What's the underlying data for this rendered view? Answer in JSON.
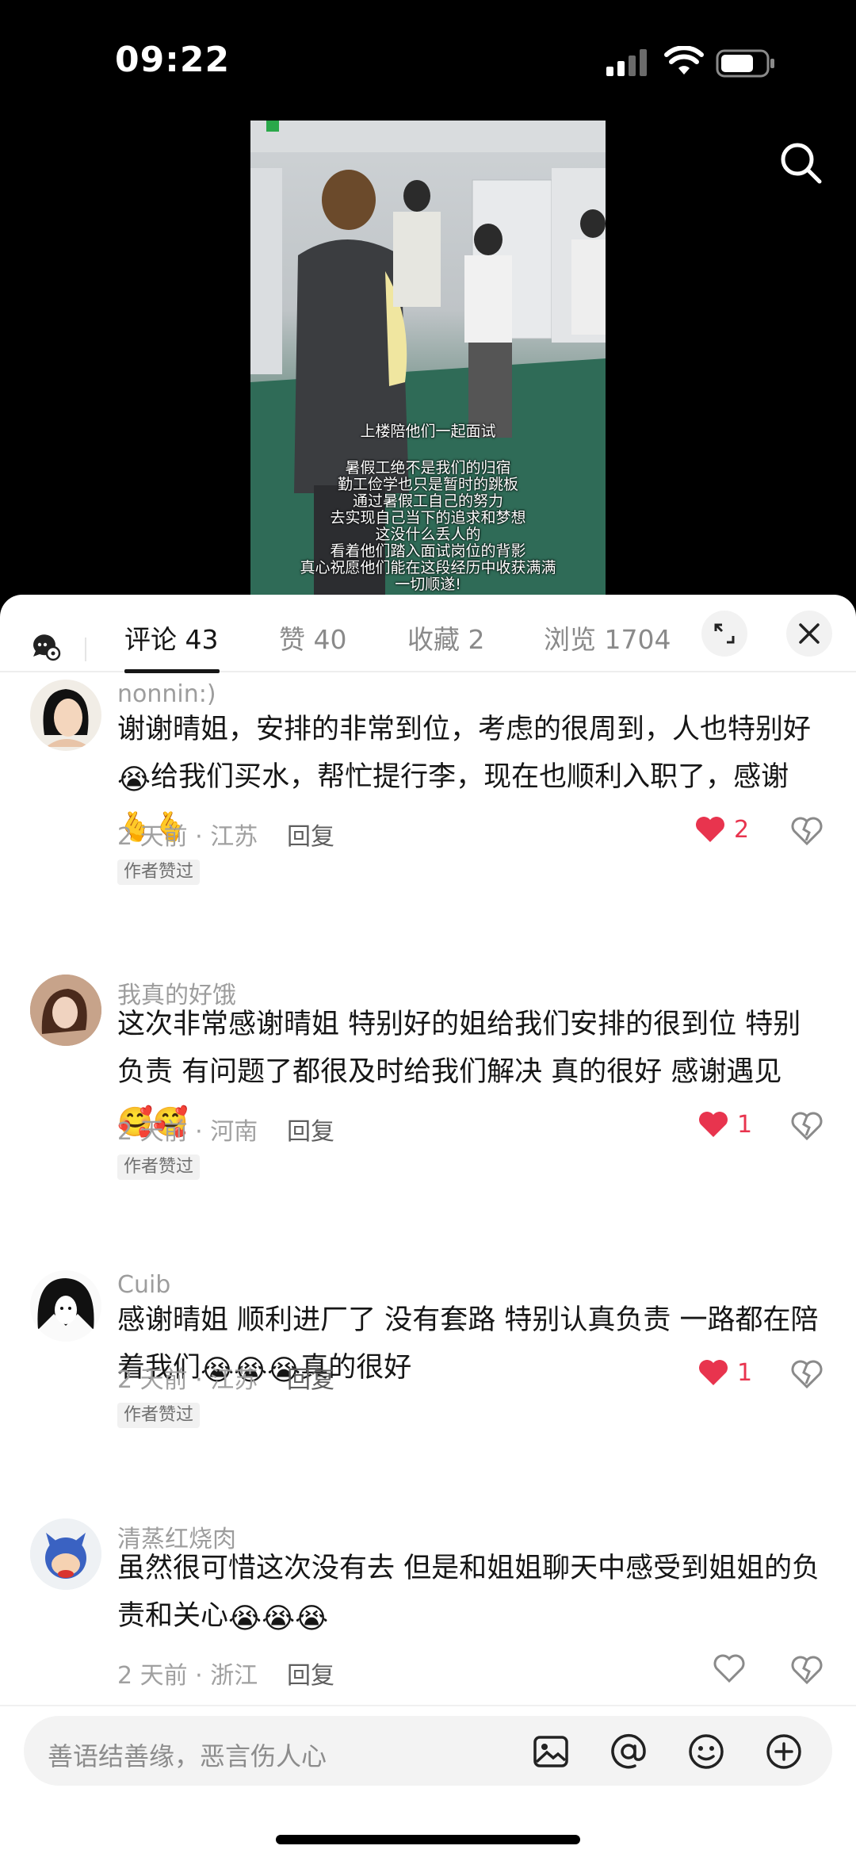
{
  "status_bar": {
    "time": "09:22"
  },
  "video": {
    "caption_title": "上楼陪他们一起面试",
    "caption_lines": [
      "暑假工绝不是我们的归宿",
      "勤工俭学也只是暂时的跳板",
      "通过暑假工自己的努力",
      "去实现自己当下的追求和梦想",
      "这没什么丢人的",
      "看着他们踏入面试岗位的背影",
      "真心祝愿他们能在这段经历中收获满满",
      "一切顺遂!"
    ]
  },
  "tabs": [
    {
      "label": "评论 43"
    },
    {
      "label": "赞 40"
    },
    {
      "label": "收藏 2"
    },
    {
      "label": "浏览 1704"
    }
  ],
  "comments": [
    {
      "username": "nonnin:)",
      "text": "谢谢晴姐，安排的非常到位，考虑的很周到，人也特别好",
      "text_after_emoji1": "给我们买水，帮忙提行李，现在也顺利入职了，感谢",
      "emoji1": "😭",
      "emoji_tail": "🫰🫰",
      "time": "2 天前 · 江苏",
      "reply": "回复",
      "likes": "2",
      "liked": true,
      "badge": "作者赞过"
    },
    {
      "username": "我真的好饿",
      "text": "这次非常感谢晴姐 特别好的姐给我们安排的很到位 特别负责 有问题了都很及时给我们解决 真的很好 感谢遇见",
      "emoji_tail": "🥰🥰",
      "time": "2 天前 · 河南",
      "reply": "回复",
      "likes": "1",
      "liked": true,
      "badge": "作者赞过"
    },
    {
      "username": "Cuib",
      "text": "感谢晴姐 顺利进厂了 没有套路 特别认真负责 一路都在陪着我们",
      "emoji_mid": "😭😭😭",
      "text_after": "真的很好",
      "time": "2 天前 · 江苏",
      "reply": "回复",
      "likes": "1",
      "liked": true,
      "badge": "作者赞过"
    },
    {
      "username": "清蒸红烧肉",
      "text": "虽然很可惜这次没有去 但是和姐姐聊天中感受到姐姐的负责和关心",
      "emoji_tail": "😭😭😭",
      "time": "2 天前 · 浙江",
      "reply": "回复",
      "likes": "",
      "liked": false
    }
  ],
  "input": {
    "placeholder": "善语结善缘，恶言伤人心"
  },
  "icons": {
    "search": "search-icon",
    "expand": "expand-icon",
    "close": "close-icon",
    "image": "image-icon",
    "at": "at-icon",
    "emoji": "emoji-icon",
    "plus": "plus-icon"
  },
  "colors": {
    "like_red": "#e8344e",
    "text": "#161616",
    "muted": "#9d9d9d"
  }
}
